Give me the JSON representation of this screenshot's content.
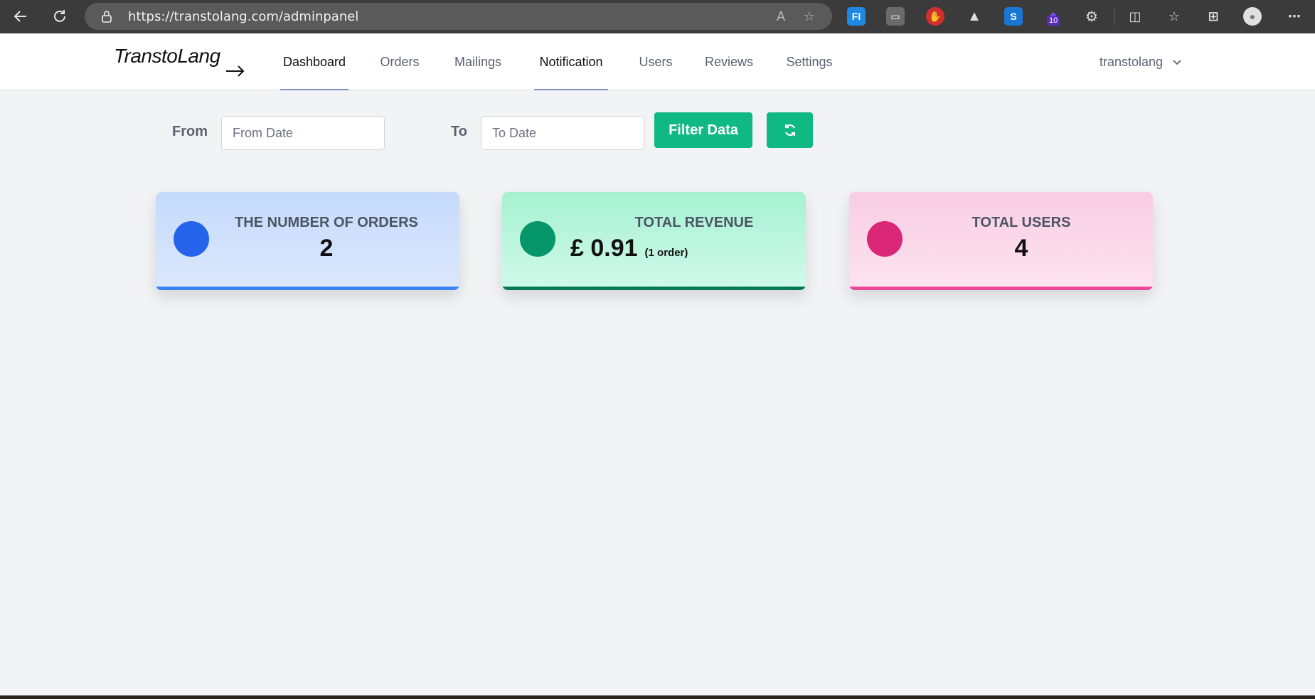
{
  "browser": {
    "url": "https://transtolang.com/adminpanel",
    "extension_badge": "10",
    "icons": [
      "back-icon",
      "reload-icon",
      "lock-icon",
      "read-aloud-icon",
      "favorite-star-icon",
      "extensions-icon",
      "split-screen-icon",
      "favorites-icon",
      "collections-icon",
      "profile-icon",
      "more-icon"
    ]
  },
  "header": {
    "logo": "TranstoLang",
    "nav": [
      {
        "label": "Dashboard",
        "active": true
      },
      {
        "label": "Orders",
        "active": false
      },
      {
        "label": "Mailings",
        "active": false
      },
      {
        "label": "Notification",
        "active": true
      },
      {
        "label": "Users",
        "active": false
      },
      {
        "label": "Reviews",
        "active": false
      },
      {
        "label": "Settings",
        "active": false
      }
    ],
    "user": "transtolang"
  },
  "filter": {
    "from_label": "From",
    "from_placeholder": "From Date",
    "to_label": "To",
    "to_placeholder": "To Date",
    "filter_button": "Filter Data"
  },
  "cards": [
    {
      "title": "THE NUMBER OF ORDERS",
      "value": "2",
      "accent": "#2563eb",
      "bar": "#3b82f6"
    },
    {
      "title": "TOTAL REVENUE",
      "value": "£ 0.91",
      "note": "(1 order)",
      "accent": "#059669",
      "bar": "#047857"
    },
    {
      "title": "TOTAL USERS",
      "value": "4",
      "accent": "#db2777",
      "bar": "#ec4899"
    }
  ]
}
